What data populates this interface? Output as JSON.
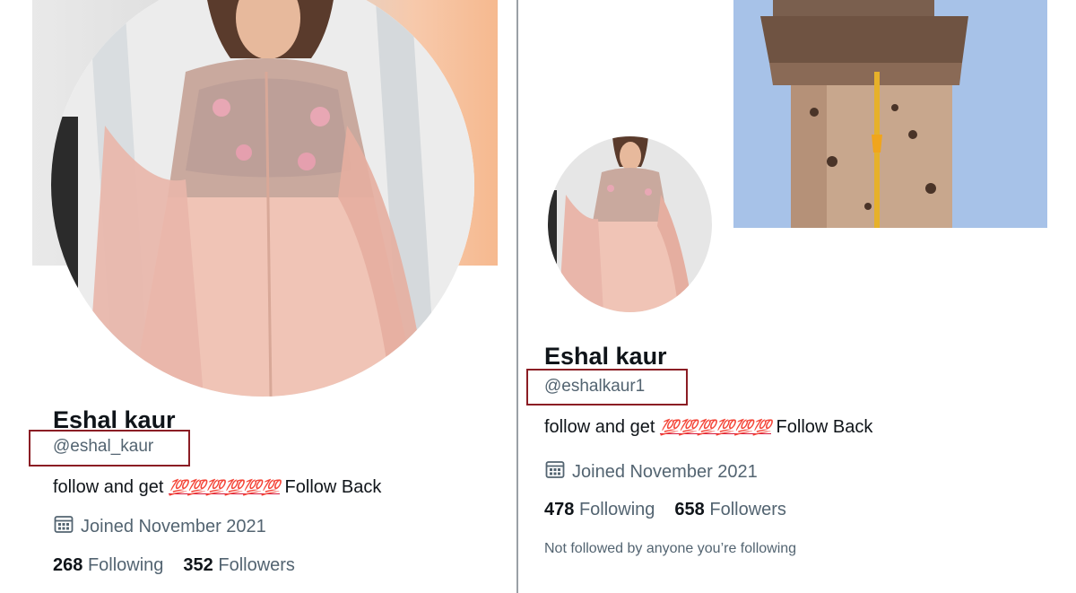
{
  "left": {
    "name": "Eshal kaur",
    "handle": "@eshal_kaur",
    "bio_before": "follow and get ",
    "bio_emoji": "💯💯💯💯💯💯",
    "bio_after": " Follow Back",
    "joined": "Joined November 2021",
    "following_count": "268",
    "following_label": "Following",
    "followers_count": "352",
    "followers_label": "Followers"
  },
  "right": {
    "name": "Eshal kaur",
    "handle": "@eshalkaur1",
    "bio_before": "follow and get ",
    "bio_emoji": "💯💯💯💯💯💯",
    "bio_after": " Follow Back",
    "joined": "Joined November 2021",
    "following_count": "478",
    "following_label": "Following",
    "followers_count": "658",
    "followers_label": "Followers",
    "not_followed": "Not followed by anyone you’re following"
  },
  "colors": {
    "highlight_box": "#8b1d24",
    "text_primary": "#0f1419",
    "text_secondary": "#536471",
    "emoji_red": "#d61a3c"
  },
  "icons": [
    "calendar-icon"
  ]
}
